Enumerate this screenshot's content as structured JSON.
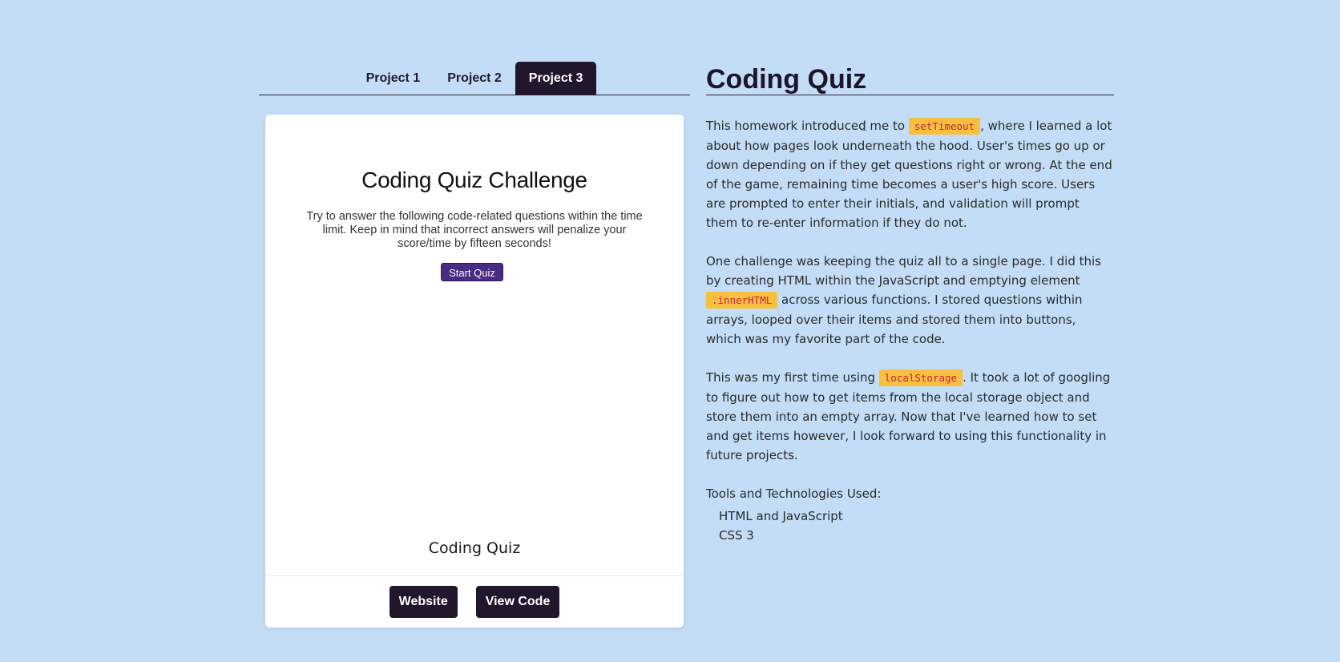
{
  "tabs": [
    {
      "label": "Project 1",
      "active": false
    },
    {
      "label": "Project 2",
      "active": false
    },
    {
      "label": "Project 3",
      "active": true
    }
  ],
  "card": {
    "preview": {
      "title": "Coding Quiz Challenge",
      "description": "Try to answer the following code-related questions within the time limit. Keep in mind that incorrect answers will penalize your score/time by fifteen seconds!",
      "start_button": "Start Quiz"
    },
    "caption": "Coding Quiz",
    "buttons": {
      "website": "Website",
      "view_code": "View Code"
    }
  },
  "project": {
    "title": "Coding Quiz",
    "paragraphs": [
      {
        "before": "This homework introduced me to ",
        "code": "setTimeout",
        "after": ", where I learned a lot about how pages look underneath the hood. User's times go up or down depending on if they get questions right or wrong. At the end of the game, remaining time becomes a user's high score. Users are prompted to enter their initials, and validation will prompt them to re-enter information if they do not."
      },
      {
        "before": "One challenge was keeping the quiz all to a single page. I did this by creating HTML within the JavaScript and emptying element ",
        "code": ".innerHTML",
        "after": " across various functions. I stored questions within arrays, looped over their items and stored them into buttons, which was my favorite part of the code."
      },
      {
        "before": "This was my first time using ",
        "code": "localStorage",
        "after": ". It took a lot of googling to figure out how to get items from the local storage object and store them into an empty array. Now that I've learned how to set and get items however, I look forward to using this functionality in future projects."
      }
    ],
    "tools_title": "Tools and Technologies Used:",
    "tools": [
      "HTML and JavaScript",
      "CSS 3"
    ]
  },
  "colors": {
    "background": "#c2ddf5",
    "accent_dark": "#22162d",
    "code_bg": "#f9bf3e",
    "code_text": "#c1234a",
    "quiz_button": "#4a2a82"
  }
}
